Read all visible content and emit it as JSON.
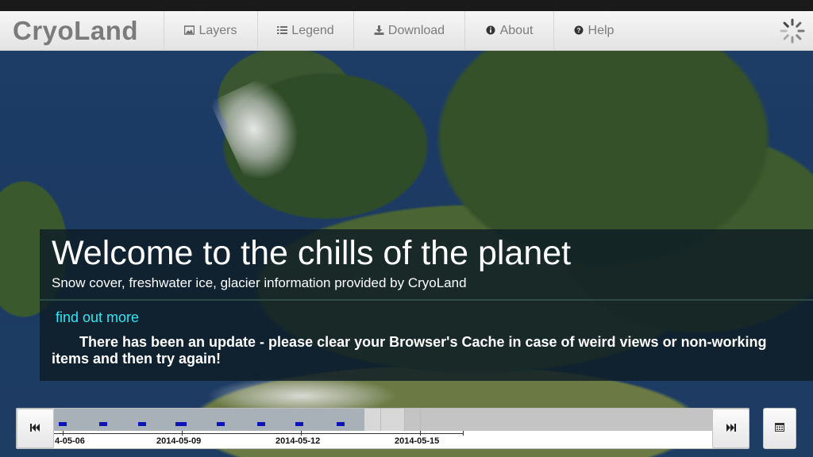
{
  "app": {
    "brand": "CryoLand"
  },
  "nav": {
    "items": [
      {
        "label": "Layers",
        "icon": "image-icon"
      },
      {
        "label": "Legend",
        "icon": "list-icon"
      },
      {
        "label": "Download",
        "icon": "download-icon"
      },
      {
        "label": "About",
        "icon": "info-icon"
      },
      {
        "label": "Help",
        "icon": "help-icon"
      }
    ]
  },
  "welcome": {
    "title": "Welcome to the chills of the planet",
    "subtitle": "Snow cover, freshwater ice, glacier information provided by CryoLand",
    "link": "find out more",
    "notice": "There has been an update - please clear your Browser's Cache in case of weird views or non-working items and then try again!"
  },
  "timeline": {
    "labels": [
      "4-05-06",
      "2014-05-09",
      "2014-05-12",
      "2014-05-15"
    ],
    "prev_icon": "skip-back-icon",
    "next_icon": "skip-forward-icon",
    "calendar_icon": "calendar-icon"
  },
  "colors": {
    "link": "#31e7f2",
    "timeline_marker": "#0a14b8",
    "nav_text": "#7c7c7c"
  }
}
